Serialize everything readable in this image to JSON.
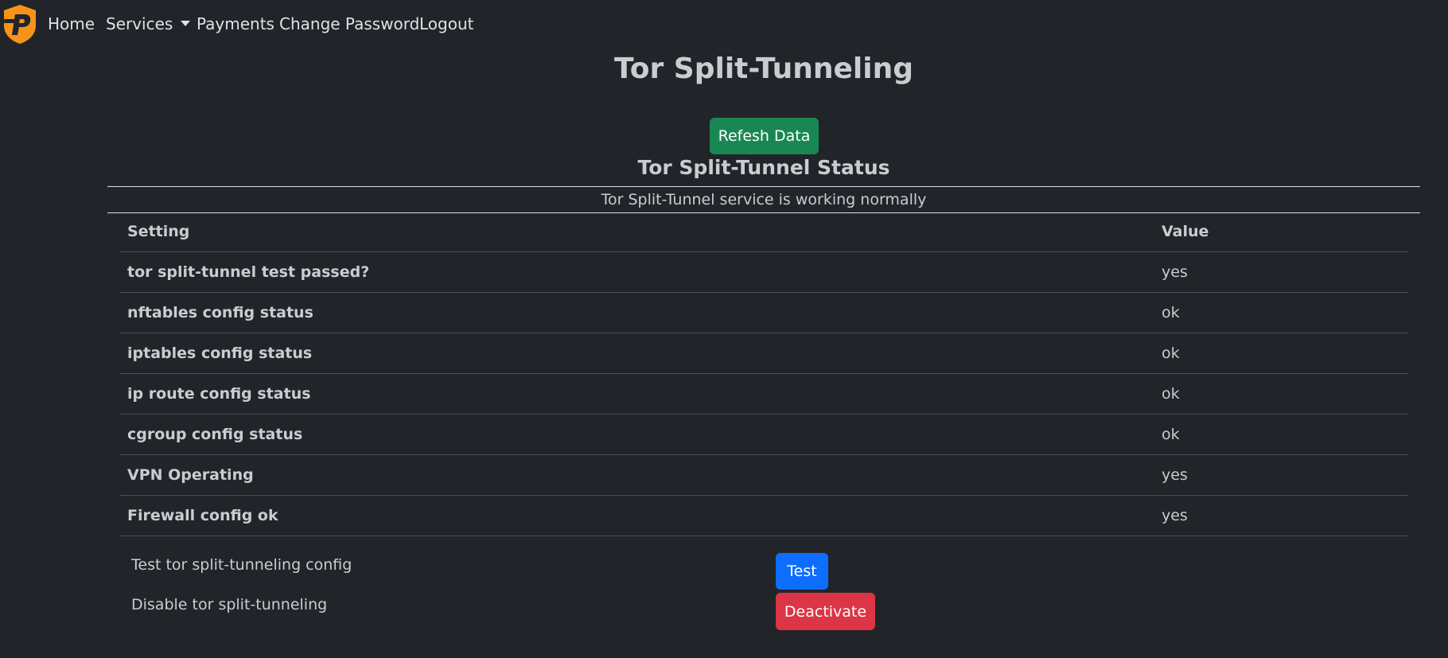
{
  "nav": {
    "items": [
      {
        "label": "Home"
      },
      {
        "label": "Services"
      },
      {
        "label": "Payments"
      },
      {
        "label": "Change Password"
      },
      {
        "label": "Logout"
      }
    ]
  },
  "colors": {
    "background": "#212529",
    "logo": "#f7931a",
    "success": "#198754",
    "primary": "#0d6efd",
    "danger": "#dc3545"
  },
  "page": {
    "title": "Tor Split-Tunneling",
    "refresh_button": "Refesh Data",
    "section_title": "Tor Split-Tunnel Status",
    "status_message": "Tor Split-Tunnel service is working normally"
  },
  "table": {
    "headers": {
      "setting": "Setting",
      "value": "Value"
    },
    "rows": [
      {
        "setting": "tor split-tunnel test passed?",
        "value": "yes"
      },
      {
        "setting": "nftables config status",
        "value": "ok"
      },
      {
        "setting": "iptables config status",
        "value": "ok"
      },
      {
        "setting": "ip route config status",
        "value": "ok"
      },
      {
        "setting": "cgroup config status",
        "value": "ok"
      },
      {
        "setting": "VPN Operating",
        "value": "yes"
      },
      {
        "setting": "Firewall config ok",
        "value": "yes"
      }
    ]
  },
  "actions": {
    "test_label": "Test tor split-tunneling config",
    "test_button": "Test",
    "disable_label": "Disable tor split-tunneling",
    "deactivate_button": "Deactivate"
  }
}
